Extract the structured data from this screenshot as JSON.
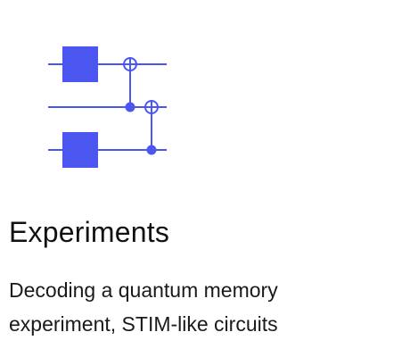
{
  "card": {
    "title": "Experiments",
    "description_lines": [
      "Decoding a quantum memory",
      "experiment, STIM-like circuits"
    ]
  },
  "icon": {
    "name": "quantum-circuit-icon",
    "accent_color": "#4b55f0"
  }
}
